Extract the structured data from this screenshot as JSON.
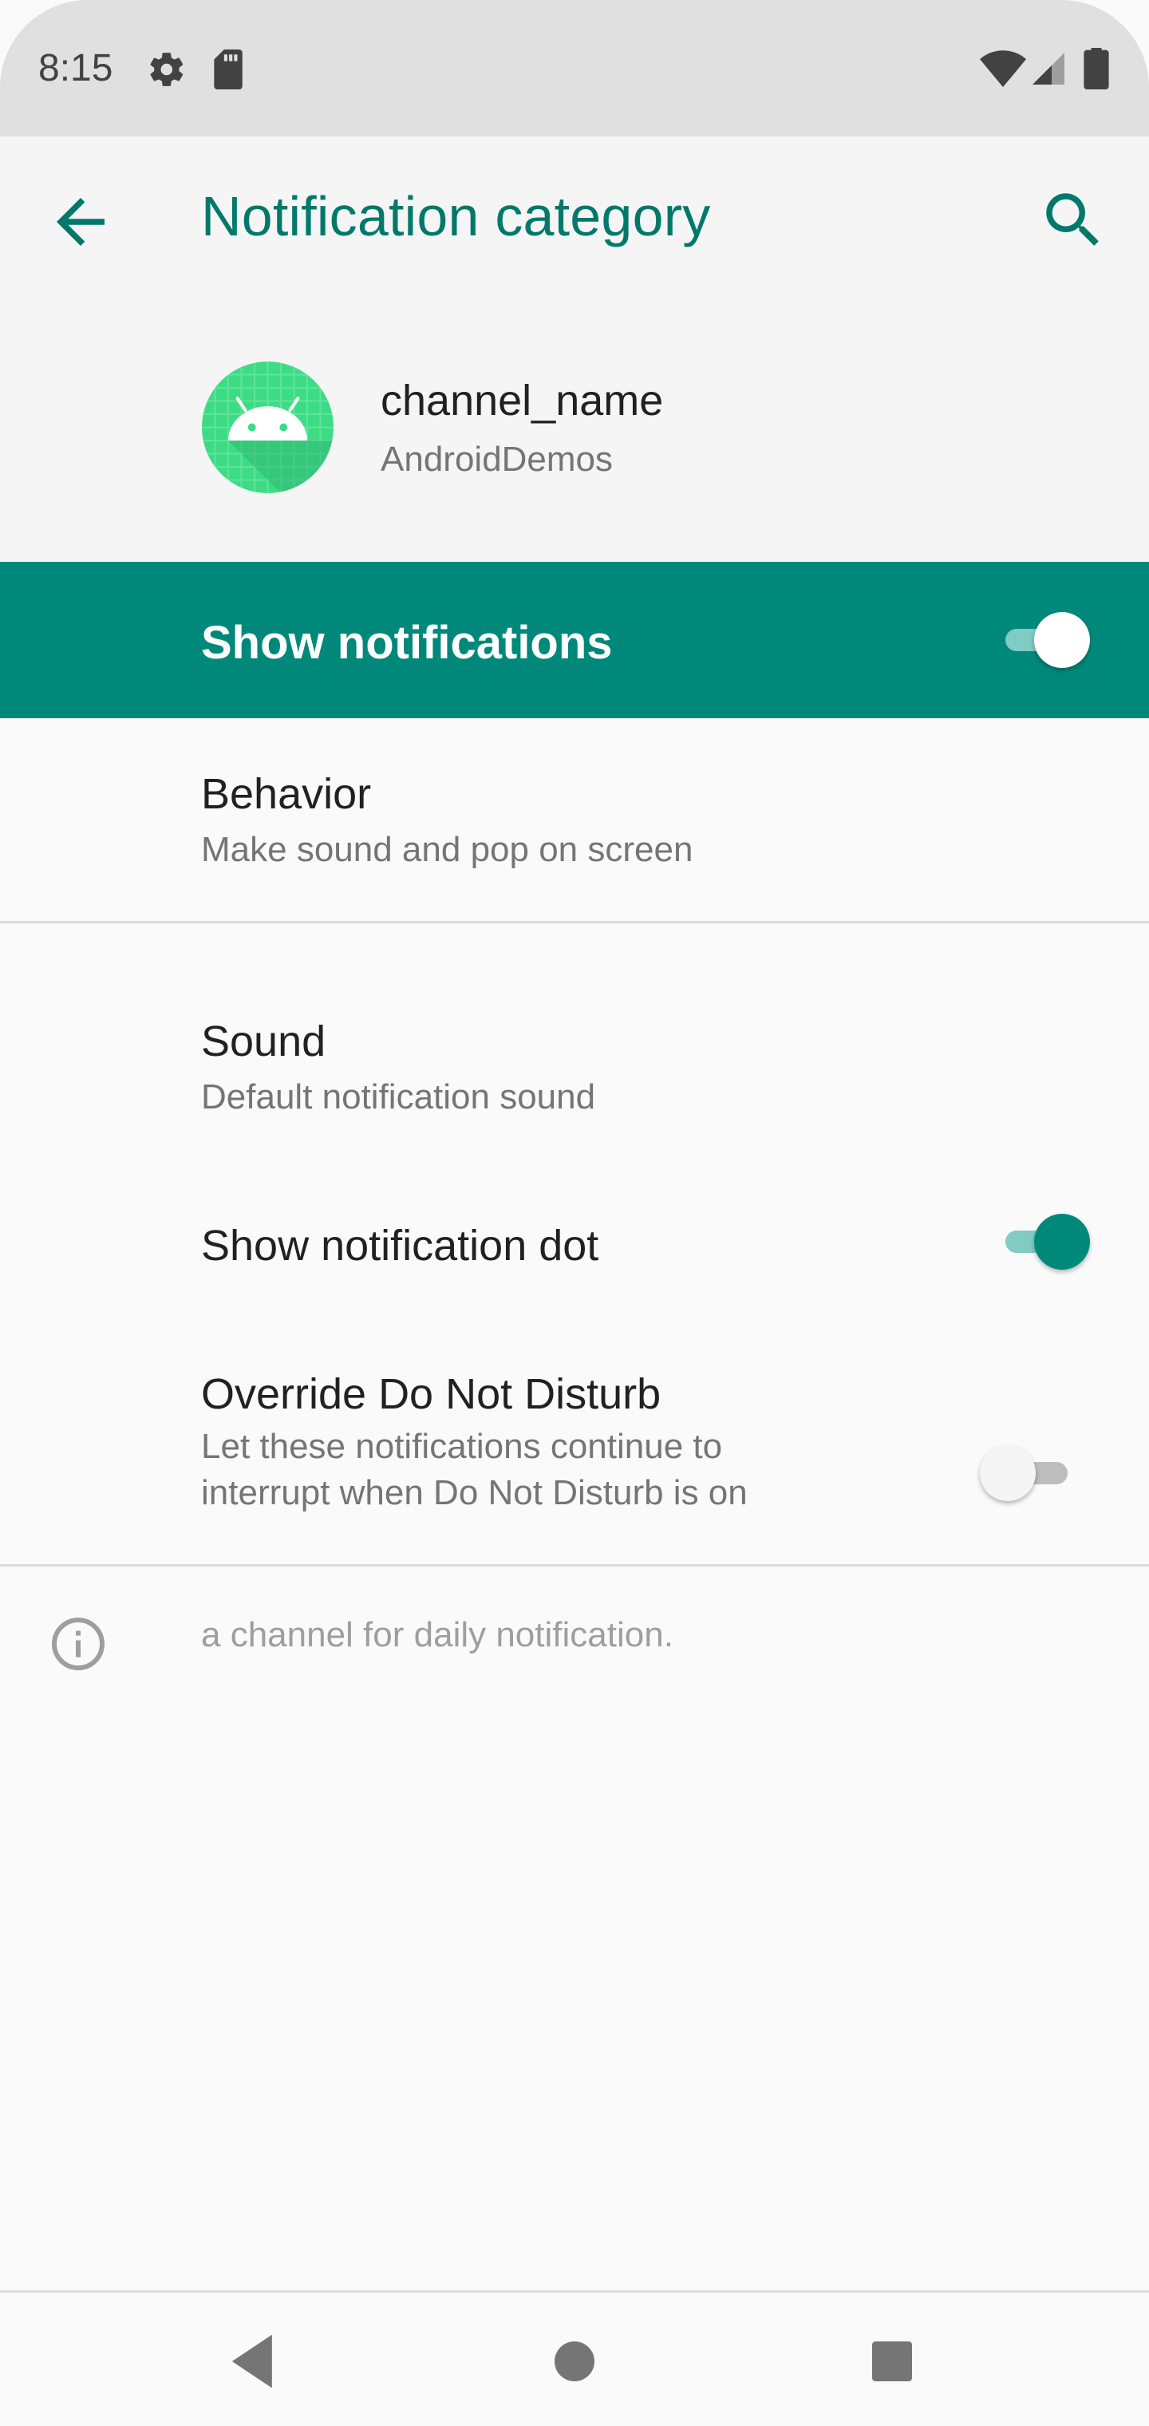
{
  "status_bar": {
    "time": "8:15",
    "icons": [
      "settings-icon",
      "sd-card-icon",
      "wifi-icon",
      "signal-icon",
      "battery-icon"
    ]
  },
  "header": {
    "title": "Notification category",
    "back_icon": "arrow-back-icon",
    "search_icon": "search-icon"
  },
  "channel": {
    "name": "channel_name",
    "app": "AndroidDemos",
    "icon": "android-app-icon"
  },
  "master_toggle": {
    "label": "Show notifications",
    "checked": true
  },
  "settings": {
    "behavior": {
      "title": "Behavior",
      "summary": "Make sound and pop on screen"
    },
    "sound": {
      "title": "Sound",
      "summary": "Default notification sound"
    },
    "dot": {
      "title": "Show notification dot",
      "checked": true
    },
    "dnd": {
      "title": "Override Do Not Disturb",
      "summary_line1": "Let these notifications continue to",
      "summary_line2": "interrupt when Do Not Disturb is on",
      "checked": false
    }
  },
  "footer": {
    "info_icon": "info-icon",
    "text": "a channel for daily notification."
  },
  "nav_bar": {
    "buttons": [
      "back-triangle-icon",
      "home-circle-icon",
      "recents-square-icon"
    ]
  },
  "colors": {
    "accent": "#00796b",
    "master_bar": "#00897b",
    "switch_track_on": "#80cbc4"
  }
}
